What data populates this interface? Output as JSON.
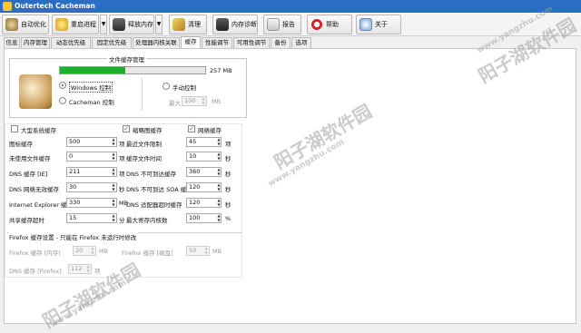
{
  "window": {
    "title": "Outertech Cacheman"
  },
  "toolbar": {
    "auto_optimize": "自动优化",
    "restart_process": "重启进程",
    "free_memory": "释放内存",
    "cleanup": "清理",
    "memory_diagnosis": "内存诊断",
    "report": "报告",
    "help": "帮助",
    "about": "关于"
  },
  "tabs": [
    "信息",
    "内存管理",
    "动态优先级",
    "固定优先级",
    "处理器内核关联",
    "缓存",
    "性能调节",
    "可用性调节",
    "备份",
    "选项"
  ],
  "file_cache": {
    "title": "文件缓存管理",
    "size": "257 MB",
    "progress": 0.45,
    "windows_control": "Windows 控制",
    "cacheman_control": "Cacheman 控制",
    "manual_control": "手动控制",
    "max_label": "最大",
    "max_value": "100",
    "max_unit": "MB"
  },
  "col1": {
    "check_label": "大型系统缓存",
    "rows": [
      {
        "label": "图标缓存",
        "value": "500",
        "unit": "项"
      },
      {
        "label": "未使用文件缓存",
        "value": "0",
        "unit": "项"
      },
      {
        "label": "DNS 缓存 [IE]",
        "value": "211",
        "unit": "项"
      },
      {
        "label": "DNS 网络无效缓存",
        "value": "30",
        "unit": "秒"
      },
      {
        "label": "Internet Explorer 缓存",
        "value": "330",
        "unit": "MB"
      },
      {
        "label": "共享缓存超时",
        "value": "15",
        "unit": "分"
      }
    ]
  },
  "col2": {
    "check_label": "缩略图缓存",
    "rows": [
      {
        "label": "最近文件限制",
        "value": "45",
        "unit": "项"
      },
      {
        "label": "缓存文件时间",
        "value": "10",
        "unit": "秒"
      },
      {
        "label": "DNS 不可到达缓存",
        "value": "360",
        "unit": "秒"
      },
      {
        "label": "DNS 不可到达 SOA 缓存",
        "value": "120",
        "unit": "秒"
      },
      {
        "label": "DNS 适配器超时缓存",
        "value": "120",
        "unit": "秒"
      },
      {
        "label": "最大寄存内核数",
        "value": "100",
        "unit": "%"
      }
    ]
  },
  "col3": {
    "check_label": "网络缓存"
  },
  "firefox": {
    "title": "Firefox 缓存设置 - 只能在 Firefox 未运行时修改",
    "memory_label": "Firefox 缓存 [内存]",
    "memory_value": "20",
    "memory_unit": "MB",
    "disk_label": "Firefox 缓存 [磁盘]",
    "disk_value": "50",
    "disk_unit": "MB",
    "dns_label": "DNS 缓存 [Firefox]",
    "dns_value": "112",
    "dns_unit": "项"
  },
  "watermarks": [
    "www.yangzhu.com",
    "阳子湖软件园",
    "www.yangzhu.com",
    "阳子湖软件园",
    "www.yangzhu.com",
    "阳子湖软件园"
  ]
}
